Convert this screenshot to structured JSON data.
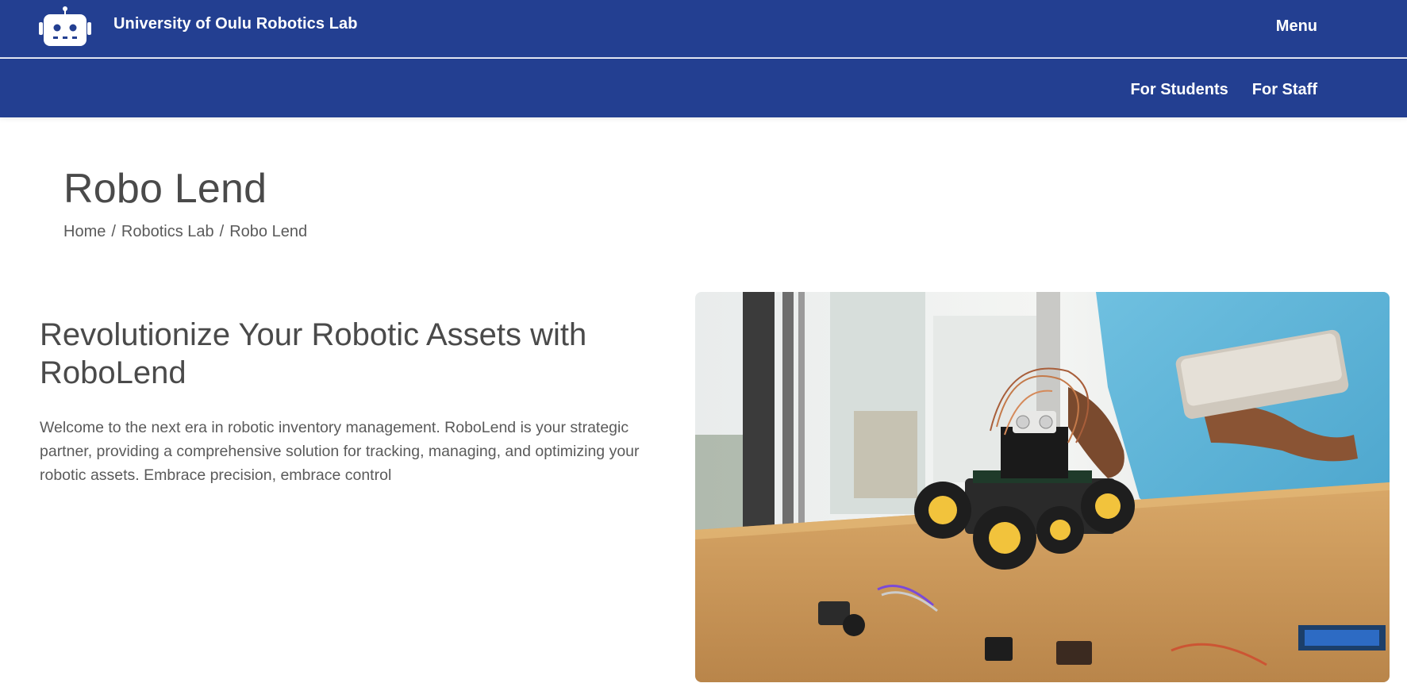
{
  "header": {
    "site_title": "University of Oulu Robotics Lab",
    "logo_icon": "robot-head-icon",
    "menu_label": "Menu"
  },
  "subnav": {
    "items": [
      {
        "label": "For Students"
      },
      {
        "label": "For Staff"
      }
    ]
  },
  "page": {
    "title": "Robo Lend",
    "breadcrumb": [
      "Home",
      "Robotics Lab",
      "Robo Lend"
    ],
    "breadcrumb_separator": "/"
  },
  "hero": {
    "heading": "Revolutionize Your Robotic Assets with RoboLend",
    "body": "Welcome to the next era in robotic inventory management. RoboLend is your strategic partner, providing a comprehensive solution for tracking, managing, and optimizing your robotic assets. Embrace precision, embrace control",
    "image_icon": "robot-car-photo"
  },
  "colors": {
    "brand_blue": "#233f91",
    "text": "#4a4a4a",
    "background": "#ffffff"
  }
}
